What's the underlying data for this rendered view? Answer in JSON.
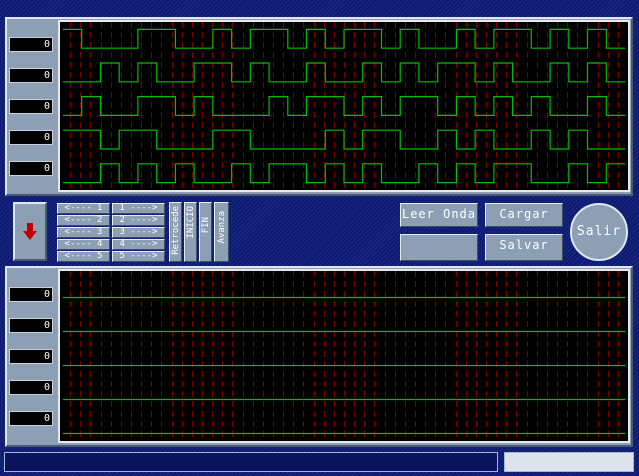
{
  "top_panel": {
    "values": [
      "0",
      "0",
      "0",
      "0",
      "0"
    ],
    "waves": [
      [
        1,
        0,
        0,
        0,
        1,
        1,
        0,
        0,
        1,
        0,
        1,
        1,
        0,
        1,
        0,
        1,
        1,
        0,
        1,
        0,
        0,
        1,
        0,
        1,
        1,
        0,
        1,
        0,
        1,
        0
      ],
      [
        0,
        0,
        1,
        0,
        1,
        0,
        0,
        1,
        1,
        0,
        1,
        0,
        0,
        1,
        0,
        0,
        1,
        0,
        1,
        0,
        1,
        1,
        0,
        1,
        0,
        0,
        1,
        0,
        1,
        0
      ],
      [
        0,
        1,
        0,
        0,
        1,
        1,
        0,
        1,
        0,
        0,
        0,
        1,
        0,
        1,
        1,
        0,
        1,
        0,
        1,
        1,
        0,
        1,
        0,
        1,
        0,
        1,
        0,
        0,
        1,
        0
      ],
      [
        1,
        1,
        0,
        1,
        1,
        0,
        0,
        0,
        1,
        1,
        0,
        0,
        0,
        0,
        1,
        0,
        1,
        1,
        0,
        0,
        1,
        0,
        1,
        0,
        0,
        1,
        0,
        1,
        0,
        0
      ],
      [
        0,
        0,
        1,
        0,
        1,
        0,
        1,
        0,
        0,
        1,
        0,
        1,
        1,
        0,
        1,
        0,
        1,
        0,
        0,
        1,
        0,
        1,
        0,
        1,
        1,
        0,
        0,
        1,
        0,
        1
      ]
    ]
  },
  "bottom_panel": {
    "values": [
      "0",
      "0",
      "0",
      "0",
      "0"
    ],
    "waves": [
      [
        0,
        0,
        0,
        0,
        0,
        0,
        0,
        0,
        0,
        0,
        0,
        0,
        0,
        0,
        0,
        0,
        0,
        0,
        0,
        0,
        0,
        0,
        0,
        0,
        0,
        0,
        0,
        0,
        0,
        0
      ],
      [
        0,
        0,
        0,
        0,
        0,
        0,
        0,
        0,
        0,
        0,
        0,
        0,
        0,
        0,
        0,
        0,
        0,
        0,
        0,
        0,
        0,
        0,
        0,
        0,
        0,
        0,
        0,
        0,
        0,
        0
      ],
      [
        0,
        0,
        0,
        0,
        0,
        0,
        0,
        0,
        0,
        0,
        0,
        0,
        0,
        0,
        0,
        0,
        0,
        0,
        0,
        0,
        0,
        0,
        0,
        0,
        0,
        0,
        0,
        0,
        0,
        0
      ],
      [
        0,
        0,
        0,
        0,
        0,
        0,
        0,
        0,
        0,
        0,
        0,
        0,
        0,
        0,
        0,
        0,
        0,
        0,
        0,
        0,
        0,
        0,
        0,
        0,
        0,
        0,
        0,
        0,
        0,
        0
      ],
      [
        0,
        0,
        0,
        0,
        0,
        0,
        0,
        0,
        0,
        0,
        0,
        0,
        0,
        0,
        0,
        0,
        0,
        0,
        0,
        0,
        0,
        0,
        0,
        0,
        0,
        0,
        0,
        0,
        0,
        0
      ]
    ]
  },
  "controls": {
    "left_buttons": [
      "<---- 1",
      "<---- 2",
      "<---- 3",
      "<---- 4",
      "<---- 5"
    ],
    "right_buttons": [
      "1 ---->",
      "2 ---->",
      "3 ---->",
      "4 ---->",
      "5 ---->"
    ],
    "retrocede": "Retrocede",
    "inicio": "INICIO",
    "fin": "FIN",
    "avanza": "Avanza",
    "leer_onda": "Leer Onda",
    "cargar": "Cargar",
    "salvar": "Salvar",
    "blank": "",
    "salir": "Salir",
    "arrow_icon": "down-arrow-icon"
  },
  "colors": {
    "scope_bg": "#000000",
    "grid": "#7a0000",
    "trace": "#00c000",
    "panel": "#8d9fb5",
    "background": "#0d1a73"
  },
  "status": {
    "left_text": "",
    "right_text": ""
  }
}
